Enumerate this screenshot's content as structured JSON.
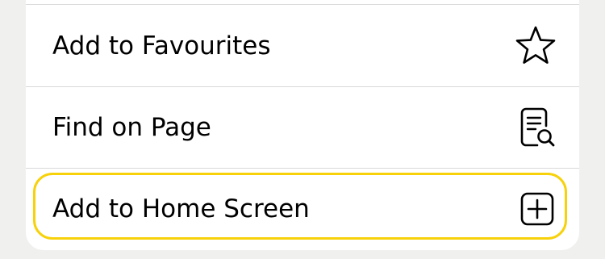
{
  "menu": {
    "items": [
      {
        "label": "Add to Favourites",
        "icon": "star-outline-icon"
      },
      {
        "label": "Find on Page",
        "icon": "document-search-icon"
      },
      {
        "label": "Add to Home Screen",
        "icon": "plus-square-icon"
      }
    ]
  },
  "colors": {
    "background": "#f0f0ef",
    "sheet": "#ffffff",
    "divider": "#d9d9d9",
    "highlight": "#f7d10a"
  }
}
